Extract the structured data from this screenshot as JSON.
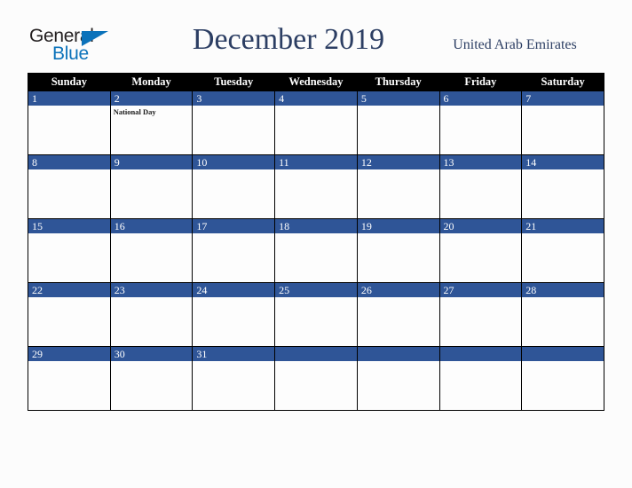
{
  "brand": {
    "name_part1": "General",
    "name_part2": "Blue",
    "triangle_icon": "triangle-icon",
    "color_dark": "#231f20",
    "color_blue": "#0b72ba"
  },
  "header": {
    "title": "December 2019",
    "country": "United Arab Emirates",
    "title_color": "#2c3e63"
  },
  "theme": {
    "header_row_bg": "#000000",
    "header_row_text": "#ffffff",
    "daynum_bg": "#2f5597",
    "daynum_text": "#ffffff",
    "cell_bg": "#fdfdfd",
    "page_bg": "#fcfcfc",
    "border": "#000000"
  },
  "weekdays": [
    "Sunday",
    "Monday",
    "Tuesday",
    "Wednesday",
    "Thursday",
    "Friday",
    "Saturday"
  ],
  "weeks": [
    [
      {
        "day": "1",
        "events": []
      },
      {
        "day": "2",
        "events": [
          "National Day"
        ]
      },
      {
        "day": "3",
        "events": []
      },
      {
        "day": "4",
        "events": []
      },
      {
        "day": "5",
        "events": []
      },
      {
        "day": "6",
        "events": []
      },
      {
        "day": "7",
        "events": []
      }
    ],
    [
      {
        "day": "8",
        "events": []
      },
      {
        "day": "9",
        "events": []
      },
      {
        "day": "10",
        "events": []
      },
      {
        "day": "11",
        "events": []
      },
      {
        "day": "12",
        "events": []
      },
      {
        "day": "13",
        "events": []
      },
      {
        "day": "14",
        "events": []
      }
    ],
    [
      {
        "day": "15",
        "events": []
      },
      {
        "day": "16",
        "events": []
      },
      {
        "day": "17",
        "events": []
      },
      {
        "day": "18",
        "events": []
      },
      {
        "day": "19",
        "events": []
      },
      {
        "day": "20",
        "events": []
      },
      {
        "day": "21",
        "events": []
      }
    ],
    [
      {
        "day": "22",
        "events": []
      },
      {
        "day": "23",
        "events": []
      },
      {
        "day": "24",
        "events": []
      },
      {
        "day": "25",
        "events": []
      },
      {
        "day": "26",
        "events": []
      },
      {
        "day": "27",
        "events": []
      },
      {
        "day": "28",
        "events": []
      }
    ],
    [
      {
        "day": "29",
        "events": []
      },
      {
        "day": "30",
        "events": []
      },
      {
        "day": "31",
        "events": []
      },
      {
        "day": "",
        "events": []
      },
      {
        "day": "",
        "events": []
      },
      {
        "day": "",
        "events": []
      },
      {
        "day": "",
        "events": []
      }
    ]
  ]
}
